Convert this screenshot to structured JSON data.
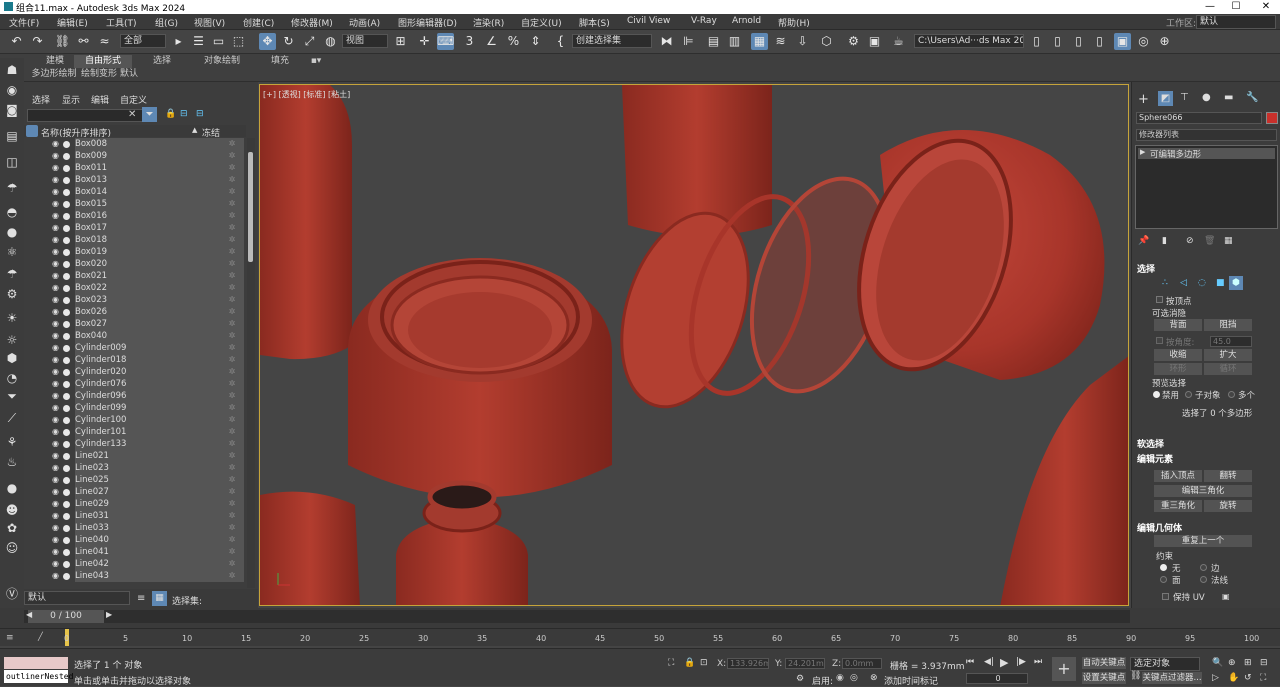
{
  "window": {
    "title": "组合11.max - Autodesk 3ds Max 2024"
  },
  "menu": [
    "文件(F)",
    "编辑(E)",
    "工具(T)",
    "组(G)",
    "视图(V)",
    "创建(C)",
    "修改器(M)",
    "动画(A)",
    "图形编辑器(D)",
    "渲染(R)",
    "自定义(U)",
    "脚本(S)",
    "Civil View",
    "V-Ray",
    "Arnold",
    "帮助(H)"
  ],
  "workspace": {
    "label": "工作区:",
    "value": "默认"
  },
  "toolbar": {
    "filter": "全部",
    "ref_coord": "视图",
    "selection_set": "创建选择集",
    "path": "C:\\Users\\Ad···ds Max 2024"
  },
  "ribbon": {
    "tabs": [
      "建模",
      "自由形式",
      "选择",
      "对象绘制",
      "填充"
    ],
    "active_tab": "自由形式",
    "subtabs": [
      "多边形绘制",
      "绘制变形",
      "默认"
    ]
  },
  "scene_explorer": {
    "menu": [
      "选择",
      "显示",
      "编辑",
      "自定义"
    ],
    "col_name": "名称(按升序排序)",
    "col_sort": "▲",
    "col_frozen": "冻结",
    "rows": [
      "Box008",
      "Box009",
      "Box011",
      "Box013",
      "Box014",
      "Box015",
      "Box016",
      "Box017",
      "Box018",
      "Box019",
      "Box020",
      "Box021",
      "Box022",
      "Box023",
      "Box026",
      "Box027",
      "Box040",
      "Cylinder009",
      "Cylinder018",
      "Cylinder020",
      "Cylinder076",
      "Cylinder096",
      "Cylinder099",
      "Cylinder100",
      "Cylinder101",
      "Cylinder133",
      "Line021",
      "Line023",
      "Line025",
      "Line027",
      "Line029",
      "Line031",
      "Line033",
      "Line040",
      "Line041",
      "Line042",
      "Line043"
    ],
    "layer": "默认",
    "selection_set_label": "选择集:"
  },
  "viewport": {
    "label": "[+] [透视] [标准] [粘土]"
  },
  "command_panel": {
    "object_name": "Sphere066",
    "object_color": "#c8302b",
    "modifier_list": "修改器列表",
    "stack_item": "可编辑多边形",
    "rollouts": {
      "selection": "选择",
      "by_vertex": "按顶点",
      "backface_group": "可选消隐",
      "back": "背面",
      "occluded": "阻挡",
      "by_angle": "按角度:",
      "angle_value": "45.0",
      "shrink": "收缩",
      "grow": "扩大",
      "ring": "环形",
      "loop": "循环",
      "preview_selection": "预览选择",
      "preview_opts": [
        "禁用",
        "子对象",
        "多个"
      ],
      "selected_info": "选择了 0 个多边形",
      "soft_selection": "软选择",
      "edit_elements": "编辑元素",
      "insert_vertex": "插入顶点",
      "flip": "翻转",
      "edit_triangulation": "编辑三角化",
      "retriangulate": "重三角化",
      "turn": "旋转",
      "edit_geometry": "编辑几何体",
      "repeat_last": "重复上一个",
      "constraints": "约束",
      "constraint_opts": [
        "无",
        "边",
        "面",
        "法线"
      ],
      "preserve_uv": "保持 UV"
    }
  },
  "timeline": {
    "current": "0 / 100",
    "ticks": [
      "0",
      "5",
      "10",
      "15",
      "20",
      "25",
      "30",
      "35",
      "40",
      "45",
      "50",
      "55",
      "60",
      "65",
      "70",
      "75",
      "80",
      "85",
      "90",
      "95",
      "100"
    ]
  },
  "status": {
    "script_field": "outlinerNested",
    "selected": "选择了 1 个 对象",
    "prompt": "单击或单击并拖动以选择对象",
    "x": "133.926mm",
    "y": "24.201mm",
    "z": "0.0mm",
    "grid": "栅格 = 3.937mm",
    "enable": "启用:",
    "add_time_tag": "添加时间标记",
    "auto_key": "自动关键点",
    "set_key": "设置关键点",
    "selected_obj": "选定对象",
    "key_filters": "关键点过滤器...",
    "frame": "0"
  }
}
